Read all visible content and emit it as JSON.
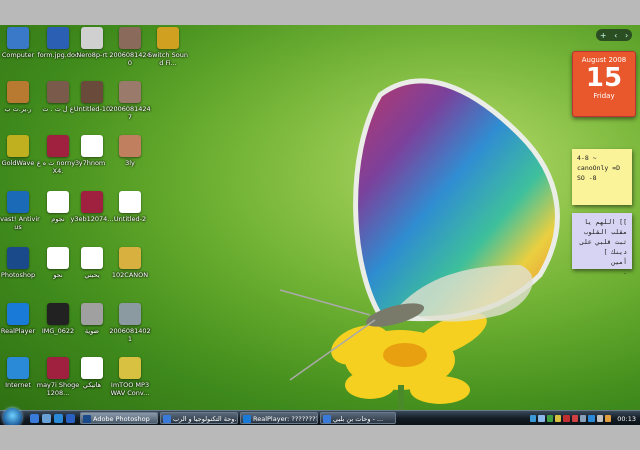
{
  "desktop": {
    "icons": [
      {
        "label": "Computer",
        "color": "#3a78c8",
        "icon": "computer-icon"
      },
      {
        "label": "form.jpg.doc",
        "color": "#2b5fb4",
        "icon": "word-document-icon"
      },
      {
        "label": "Nero8p-rt",
        "color": "#d0d0d0",
        "icon": "nero-icon"
      },
      {
        "label": "20060814240",
        "color": "#8a6a5a",
        "icon": "photo-icon"
      },
      {
        "label": "Switch Sound Fi...",
        "color": "#d0a020",
        "icon": "switch-sound-icon"
      },
      {
        "label": "ر.ير.ت ب",
        "color": "#b87a30",
        "icon": "briefcase-icon"
      },
      {
        "label": "ع ل ت . ت",
        "color": "#7a5a4a",
        "icon": "photo-icon"
      },
      {
        "label": "Untitled-10",
        "color": "#6a4a3a",
        "icon": "photo-icon"
      },
      {
        "label": "20060814247",
        "color": "#9a7a6a",
        "icon": "photo-icon"
      },
      {
        "label": "GoldWave",
        "color": "#c0b020",
        "icon": "goldwave-icon"
      },
      {
        "label": "ت ه ع norny3X4.",
        "color": "#a02040",
        "icon": "winrar-icon"
      },
      {
        "label": "y7hnom",
        "color": "#ffffff",
        "icon": "mp3-file-icon"
      },
      {
        "label": "3ly",
        "color": "#c08060",
        "icon": "photo-icon"
      },
      {
        "label": "avast! Antivirus",
        "color": "#1a6ab8",
        "icon": "avast-icon"
      },
      {
        "label": "نجوم",
        "color": "#ffffff",
        "icon": "image-file-icon"
      },
      {
        "label": "y3eb12074...",
        "color": "#a02040",
        "icon": "winrar-icon"
      },
      {
        "label": "Untitled-2",
        "color": "#ffffff",
        "icon": "image-file-icon"
      },
      {
        "label": "Photoshop",
        "color": "#1a4a8a",
        "icon": "photoshop-icon"
      },
      {
        "label": "نحو",
        "color": "#ffffff",
        "icon": "image-file-icon"
      },
      {
        "label": "يحبني",
        "color": "#ffffff",
        "icon": "text-file-icon"
      },
      {
        "label": "102CANON",
        "color": "#d8b040",
        "icon": "folder-icon"
      },
      {
        "label": "RealPlayer",
        "color": "#1a7ad8",
        "icon": "realplayer-icon"
      },
      {
        "label": "IMG_0622",
        "color": "#222222",
        "icon": "photo-icon"
      },
      {
        "label": "ضوية",
        "color": "#a0a0a0",
        "icon": "photo-icon"
      },
      {
        "label": "20060814021",
        "color": "#8a9aa0",
        "icon": "photo-icon"
      },
      {
        "label": "Internet",
        "color": "#2a8ad8",
        "icon": "internet-explorer-icon"
      },
      {
        "label": "may7i Shoge1208...",
        "color": "#a02040",
        "icon": "winrar-icon"
      },
      {
        "label": "هاتيكي",
        "color": "#ffffff",
        "icon": "text-file-icon"
      },
      {
        "label": "ImTOO MP3 WAV Conv...",
        "color": "#d8c040",
        "icon": "mp3-converter-icon"
      }
    ]
  },
  "sidebar": {
    "controls": [
      "+",
      "‹",
      "›"
    ],
    "calendar": {
      "month": "August 2008",
      "day": "15",
      "weekday": "Friday"
    },
    "note1": {
      "lines": [
        "4-8 ~",
        "canoOnly =D",
        "SO -8"
      ]
    },
    "note2": {
      "lines": [
        "]] اللهم يا مقلب القلوب",
        "ثبت قلبي على دينك ]",
        "أمين",
        "."
      ]
    }
  },
  "taskbar": {
    "buttons": [
      {
        "label": "Adobe Photoshop",
        "color": "#1a4a8a"
      },
      {
        "label": "وحة التكنولوجيا و الرب...",
        "color": "#3a7ad8"
      },
      {
        "label": "RealPlayer: ????????? ...",
        "color": "#1a7ad8"
      },
      {
        "label": "وحات بن بلبي - ...",
        "color": "#3a7ad8"
      }
    ],
    "clock": "00:13",
    "tray_colors": [
      "#3a9ad8",
      "#8ab8e8",
      "#40a040",
      "#d8c040",
      "#c03030",
      "#d04040",
      "#8aa0b8",
      "#2a8ad8",
      "#c0c0c0",
      "#e0a040"
    ]
  }
}
